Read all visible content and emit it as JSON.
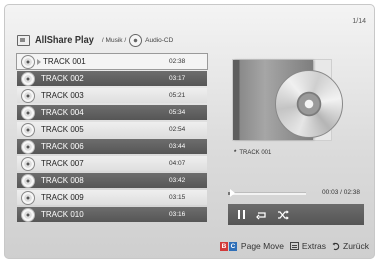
{
  "page_count": "1/14",
  "header": {
    "app_title": "AllShare Play",
    "crumb_music": "/ Musik /",
    "crumb_source": "Audio-CD"
  },
  "tracks": [
    {
      "name": "TRACK 001",
      "time": "02:38"
    },
    {
      "name": "TRACK 002",
      "time": "03:17"
    },
    {
      "name": "TRACK 003",
      "time": "05:21"
    },
    {
      "name": "TRACK 004",
      "time": "05:34"
    },
    {
      "name": "TRACK 005",
      "time": "02:54"
    },
    {
      "name": "TRACK 006",
      "time": "03:44"
    },
    {
      "name": "TRACK 007",
      "time": "04:07"
    },
    {
      "name": "TRACK 008",
      "time": "03:42"
    },
    {
      "name": "TRACK 009",
      "time": "03:15"
    },
    {
      "name": "TRACK 010",
      "time": "03:16"
    }
  ],
  "now_playing": {
    "marker": "*",
    "track": "TRACK 001",
    "time": "00:03 / 02:38",
    "progress": 0.02
  },
  "footer": {
    "key_b": "B",
    "key_c": "C",
    "page_move": "Page Move",
    "extras": "Extras",
    "back": "Zurück"
  },
  "icons": {
    "app": "allshare-icon",
    "source": "cd-icon",
    "pause": "pause-icon",
    "repeat": "repeat-icon",
    "shuffle": "shuffle-icon",
    "extras": "extras-icon",
    "back": "return-icon"
  },
  "colors": {
    "key_b": "#d23a3a",
    "key_c": "#2f6fb8",
    "row_dark": "#5e5e5e",
    "row_light": "#e6e6e6"
  }
}
